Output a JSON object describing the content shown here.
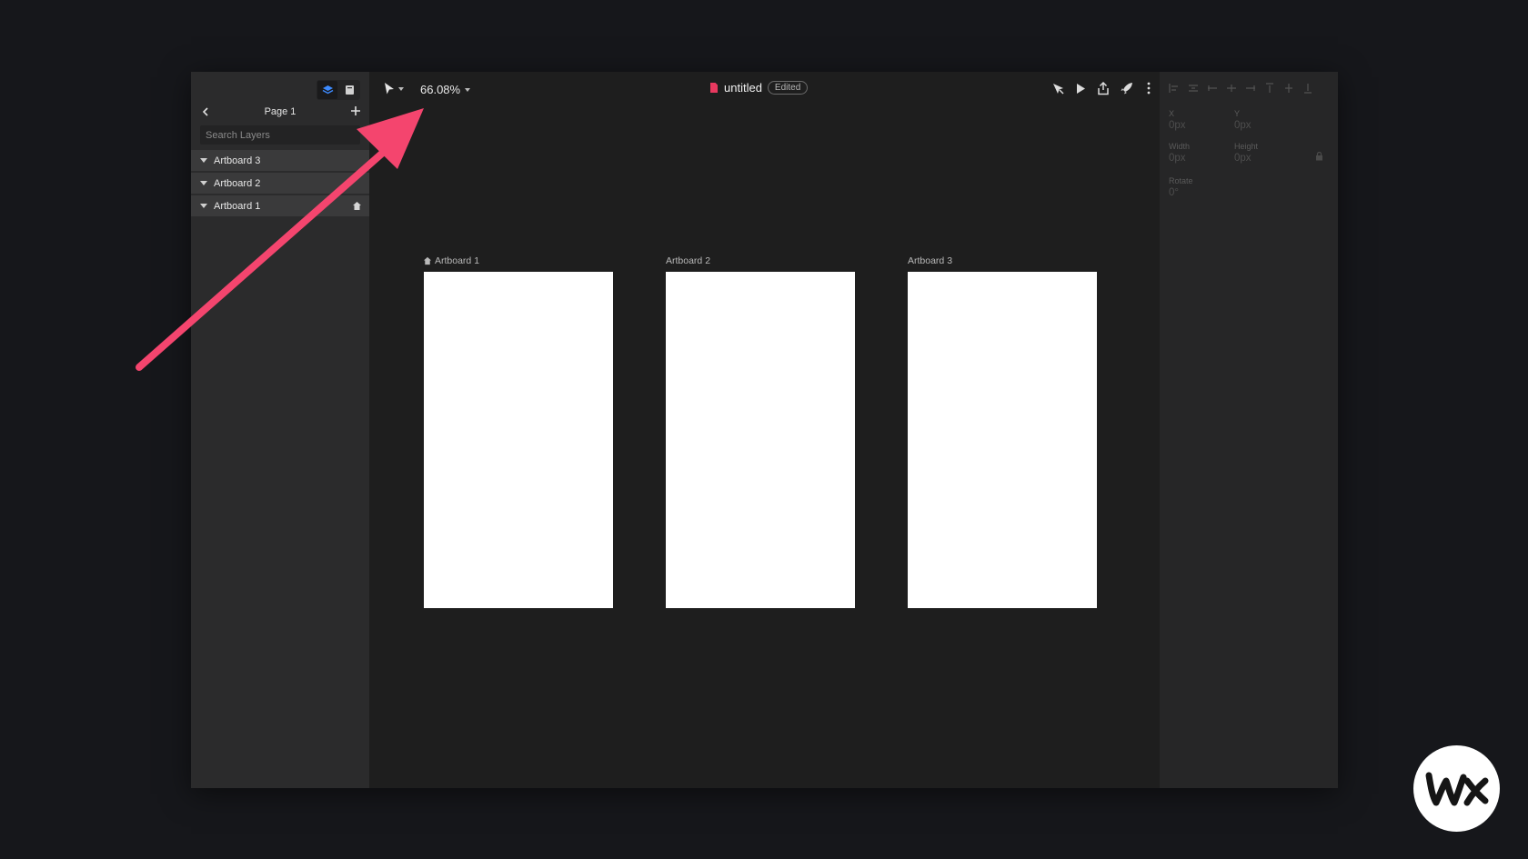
{
  "layers_panel": {
    "page_label": "Page 1",
    "search_placeholder": "Search Layers",
    "layers": [
      {
        "label": "Artboard 3"
      },
      {
        "label": "Artboard 2"
      },
      {
        "label": "Artboard 1"
      }
    ]
  },
  "toolbar": {
    "zoom": "66.08%",
    "document_title": "untitled",
    "status_badge": "Edited"
  },
  "canvas": {
    "artboards": [
      {
        "label": "Artboard 1"
      },
      {
        "label": "Artboard 2"
      },
      {
        "label": "Artboard 3"
      }
    ]
  },
  "inspector": {
    "x_label": "X",
    "x_value": "0px",
    "y_label": "Y",
    "y_value": "0px",
    "width_label": "Width",
    "width_value": "0px",
    "height_label": "Height",
    "height_value": "0px",
    "rotate_label": "Rotate",
    "rotate_value": "0°"
  },
  "colors": {
    "accent_arrow": "#f4456e",
    "document_icon": "#e8395f",
    "layers_icon_active": "#3d8bff"
  },
  "icons": [
    "layers-icon",
    "assets-icon",
    "back-chevron-icon",
    "add-page-icon",
    "home-icon",
    "select-arrow-icon",
    "component-icon",
    "play-icon",
    "share-icon",
    "publish-rocket-icon",
    "more-icon"
  ]
}
